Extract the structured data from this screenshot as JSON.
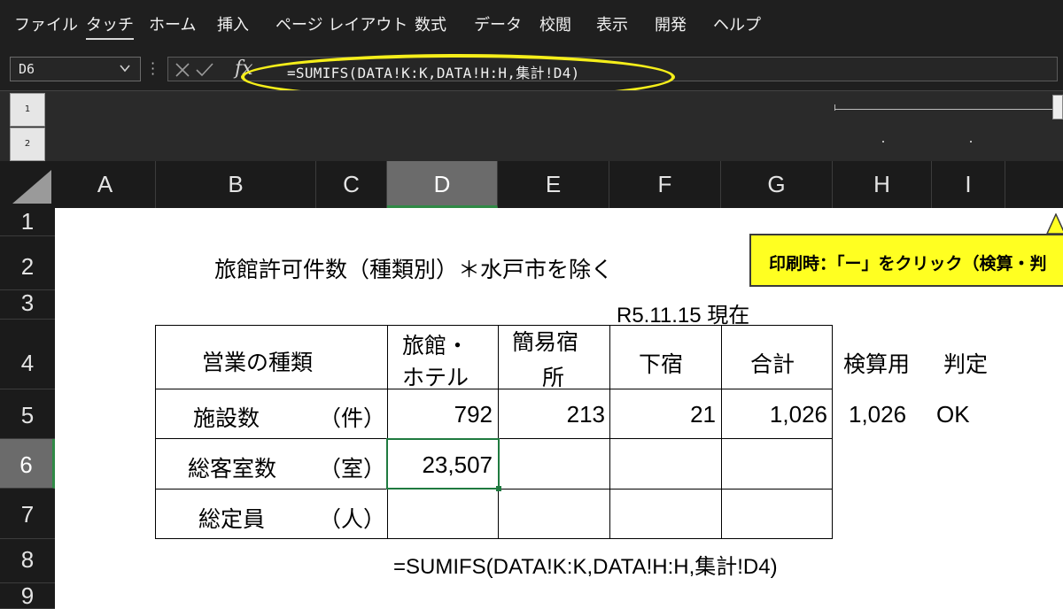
{
  "ribbon": {
    "tabs": [
      "ファイル",
      "タッチ",
      "ホーム",
      "挿入",
      "ページ レイアウト",
      "数式",
      "データ",
      "校閲",
      "表示",
      "開発",
      "ヘルプ"
    ],
    "active_tab": "タッチ"
  },
  "formula_bar": {
    "name_box": "D6",
    "fx_label": "fx",
    "formula": "=SUMIFS(DATA!K:K,DATA!H:H,集計!D4)"
  },
  "outline": {
    "levels": [
      "1",
      "2"
    ]
  },
  "columns": [
    "A",
    "B",
    "C",
    "D",
    "E",
    "F",
    "G",
    "H",
    "I"
  ],
  "rows": [
    "1",
    "2",
    "3",
    "4",
    "5",
    "6",
    "7",
    "8",
    "9"
  ],
  "selected_cell": {
    "column": "D",
    "row": "6"
  },
  "sheet": {
    "title": "旅館許可件数（種類別）＊水戸市を除く",
    "date_label": "R5.11.15 現在",
    "callout_text": "印刷時：「ー」をクリック（検算・判",
    "table": {
      "header": {
        "type": "営業の種類",
        "ryokan_line1": "旅館・",
        "ryokan_line2": "ホテル",
        "kan_i_line1": "簡易宿",
        "kan_i_line2": "所",
        "geshuku": "下宿",
        "total": "合計"
      },
      "rows": [
        {
          "label": "施設数",
          "unit": "（件）",
          "ryokan": "792",
          "kan_i": "213",
          "geshuku": "21",
          "total": "1,026"
        },
        {
          "label": "総客室数",
          "unit": "（室）",
          "ryokan": "23,507",
          "kan_i": "",
          "geshuku": "",
          "total": ""
        },
        {
          "label": "総定員",
          "unit": "（人）",
          "ryokan": "",
          "kan_i": "",
          "geshuku": "",
          "total": ""
        }
      ]
    },
    "check_header": "検算用",
    "judge_header": "判定",
    "check_value": "1,026",
    "judge_value": "OK",
    "formula_note": "=SUMIFS(DATA!K:K,DATA!H:H,集計!D4)"
  },
  "colors": {
    "highlight_ring": "#f5ee1a",
    "callout_bg": "#ffff21",
    "selection": "#1f7a3f"
  }
}
